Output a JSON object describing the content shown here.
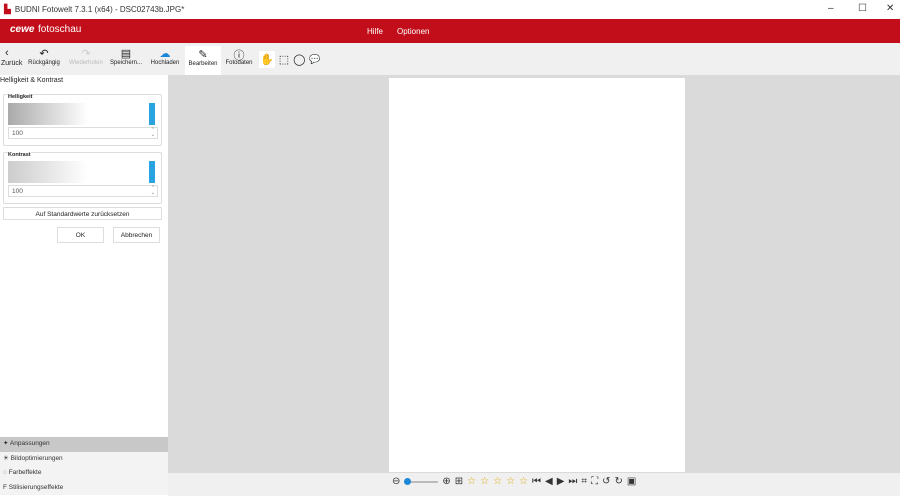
{
  "window": {
    "title": "BUDNI Fotowelt 7.3.1 (x64) - DSC02743b.JPG*",
    "minimize": "–",
    "maximize": "☐",
    "close": "✕"
  },
  "brand": {
    "logo": "cewe",
    "name": "fotoschau"
  },
  "menu": [
    "Hilfe",
    "Optionen"
  ],
  "toolbar": [
    {
      "label": "Zurück",
      "icon": "‹"
    },
    {
      "label": "Rückgängig",
      "icon": "↶"
    },
    {
      "label": "Wiederholen",
      "icon": "↷"
    },
    {
      "label": "Speichern...",
      "icon": "▤"
    },
    {
      "label": "Hochladen",
      "icon": "☁"
    },
    {
      "label": "Bearbeiten",
      "icon": "✎"
    },
    {
      "label": "Fotodaten",
      "icon": "ⓘ"
    }
  ],
  "tools": [
    "✋",
    "⬚",
    "◯",
    "💬"
  ],
  "panel": {
    "title": "Helligkeit & Kontrast",
    "brightness": {
      "label": "Helligkeit",
      "value": "100"
    },
    "contrast": {
      "label": "Kontrast",
      "value": "100"
    },
    "reset": "Auf Standardwerte zurücksetzen",
    "ok": "OK",
    "cancel": "Abbrechen"
  },
  "accordion": [
    "Anpassungen",
    "Bildoptimierungen",
    "Farbeffekte",
    "Stilisierungseffekte"
  ],
  "accordion_icons": [
    "✦",
    "☀",
    "◌",
    "F"
  ],
  "zoom_level": 0.0,
  "rating": 0,
  "bottom_icons": [
    "zoom-out",
    "zoom-in",
    "add",
    "star",
    "first",
    "prev",
    "next",
    "last",
    "crop",
    "fit",
    "rotate-left",
    "rotate-right",
    "compare"
  ]
}
